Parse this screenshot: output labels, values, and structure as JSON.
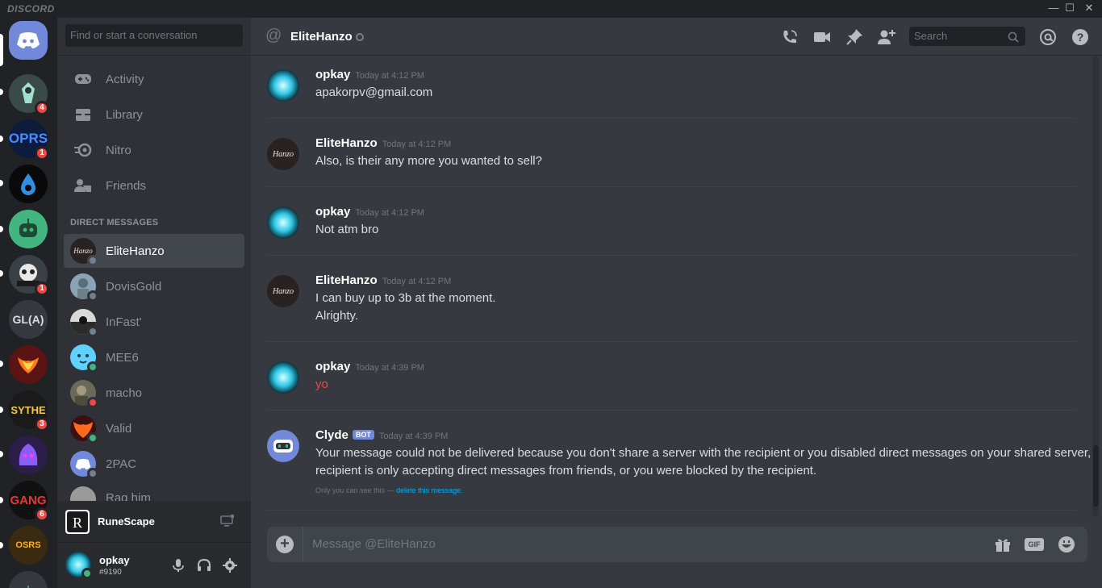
{
  "window": {
    "brand": "DISCORD",
    "minimize": "—",
    "maximize": "☐",
    "close": "✕"
  },
  "servers": [
    {
      "label": "",
      "badge": "4"
    },
    {
      "label": "",
      "badge": "1"
    },
    {
      "label": "",
      "badge": ""
    },
    {
      "label": "",
      "badge": ""
    },
    {
      "label": "",
      "badge": "1"
    },
    {
      "label": "GL(A)",
      "badge": ""
    },
    {
      "label": "",
      "badge": ""
    },
    {
      "label": "SYTHE",
      "badge": "3"
    },
    {
      "label": "",
      "badge": ""
    },
    {
      "label": "",
      "badge": "6"
    },
    {
      "label": "",
      "badge": ""
    }
  ],
  "sidebar": {
    "search_placeholder": "Find or start a conversation",
    "nav": [
      {
        "label": "Activity",
        "icon": "gamepad-icon"
      },
      {
        "label": "Library",
        "icon": "library-icon"
      },
      {
        "label": "Nitro",
        "icon": "nitro-icon"
      },
      {
        "label": "Friends",
        "icon": "friends-icon"
      }
    ],
    "dm_header": "DIRECT MESSAGES",
    "dms": [
      {
        "name": "EliteHanzo",
        "status": "offline"
      },
      {
        "name": "DovisGold",
        "status": "offline"
      },
      {
        "name": "InFast'",
        "status": "offline"
      },
      {
        "name": "MEE6",
        "status": "online"
      },
      {
        "name": "macho",
        "status": "dnd"
      },
      {
        "name": "Valid",
        "status": "online"
      },
      {
        "name": "2PAC",
        "status": "offline"
      },
      {
        "name": "Rag him",
        "status": "offline"
      }
    ],
    "activity": {
      "game": "RuneScape"
    },
    "user": {
      "name": "opkay",
      "tag": "#9190"
    }
  },
  "chat": {
    "header": {
      "at": "@",
      "name": "EliteHanzo",
      "search_placeholder": "Search"
    },
    "messages": [
      {
        "author": "opkay",
        "time": "Today at 4:12 PM",
        "lines": [
          "apakorpv@gmail.com"
        ]
      },
      {
        "author": "EliteHanzo",
        "time": "Today at 4:12 PM",
        "lines": [
          "Also, is their any more you wanted to sell?"
        ]
      },
      {
        "author": "opkay",
        "time": "Today at 4:12 PM",
        "lines": [
          "Not atm bro"
        ]
      },
      {
        "author": "EliteHanzo",
        "time": "Today at 4:12 PM",
        "lines": [
          "I can buy up to 3b at the moment.",
          "Alrighty."
        ]
      },
      {
        "author": "opkay",
        "time": "Today at 4:39 PM",
        "lines": [
          "yo"
        ]
      },
      {
        "author": "Clyde",
        "bot_tag": "BOT",
        "time": "Today at 4:39 PM",
        "lines": [
          "Your message could not be delivered because you don't share a server with the recipient or you disabled direct messages on your shared server,",
          "recipient is only accepting direct messages from friends, or you were blocked by the recipient."
        ],
        "ephemeral": "Only you can see this —",
        "ephemeral_link": "delete this message."
      }
    ],
    "composer": {
      "plus": "+",
      "placeholder": "Message @EliteHanzo",
      "gif": "GIF"
    }
  },
  "colors": {
    "accent": "#7289da",
    "online": "#43b581",
    "dnd": "#f04747",
    "offline": "#747f8d",
    "error_text": "#f04747"
  }
}
